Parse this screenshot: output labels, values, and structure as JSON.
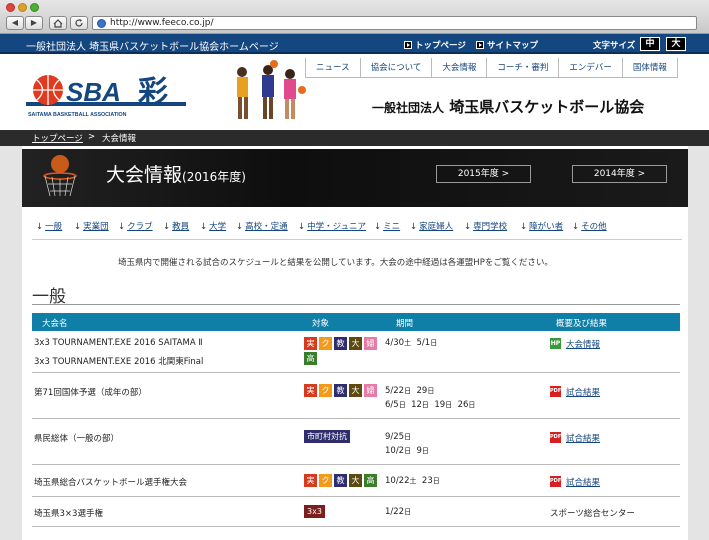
{
  "browser": {
    "back": "◀",
    "forward": "▶",
    "url": "http://www.feeco.co.jp/"
  },
  "site": {
    "topbar_title": "一般社団法人 埼玉県バスケットボール協会ホームページ",
    "topnav": [
      "トップページ",
      "サイトマップ"
    ],
    "font_size_label": "文字サイズ",
    "font_size_options": [
      "中",
      "大"
    ],
    "menu": [
      "ニュース",
      "協会について",
      "大会情報",
      "コーチ・審判",
      "エンデバー",
      "国体情報"
    ],
    "logo_text": "SBA",
    "logo_kanji": "彩",
    "logo_sub": "SAITAMA BASKETBALL ASSOCIATION",
    "org_prefix": "一般社団法人",
    "org_name": "埼玉県バスケットボール協会"
  },
  "breadcrumb": {
    "home": "トップページ",
    "sep": ">",
    "current": "大会情報"
  },
  "banner": {
    "title": "大会情報",
    "year": "(2016年度)",
    "buttons": [
      "2015年度 >",
      "2014年度 >"
    ]
  },
  "categories": [
    "一般",
    "実業団",
    "クラブ",
    "教員",
    "大学",
    "高校・定通",
    "中学・ジュニア",
    "ミニ",
    "家庭婦人",
    "専門学校",
    "障がい者",
    "その他"
  ],
  "intro": "埼玉県内で開催される試合のスケジュールと結果を公開しています。大会の途中経過は各運盟HPをご覧ください。",
  "section": "一般",
  "table": {
    "headers": [
      "大会名",
      "対象",
      "期間",
      "概要及び結果"
    ],
    "rows": [
      {
        "name1": "3x3 TOURNAMENT.EXE 2016 SAITAMA Ⅱ",
        "name2": "3x3 TOURNAMENT.EXE 2016 北関東Final",
        "tags": [
          "実",
          "ク",
          "教",
          "大",
          "婦",
          "高"
        ],
        "period1": "4/30",
        "period1_dow": "土",
        "period1b": "5/1",
        "period1b_dow": "日",
        "result_icon": "HP",
        "result": "大会情報"
      },
      {
        "name1": "第71回国体予選（成年の部）",
        "tags": [
          "実",
          "ク",
          "教",
          "大",
          "婦"
        ],
        "period1": "5/22",
        "period1_dow": "日",
        "period1b": "29",
        "period1b_dow": "日",
        "period2": "6/5",
        "period2_dow": "日",
        "period2b": "12",
        "period2b_dow": "日",
        "period2c": "19",
        "period2c_dow": "日",
        "period2d": "26",
        "period2d_dow": "日",
        "result_icon": "PDF",
        "result": "試合結果"
      },
      {
        "name1": "県民総体（一般の部）",
        "tag_wide": "市町村対抗",
        "period1": "9/25",
        "period1_dow": "日",
        "period2": "10/2",
        "period2_dow": "日",
        "period2b": "9",
        "period2b_dow": "日",
        "result_icon": "PDF",
        "result": "試合結果"
      },
      {
        "name1": "埼玉県総合バスケットボール選手権大会",
        "tags": [
          "実",
          "ク",
          "教",
          "大",
          "高"
        ],
        "period1": "10/22",
        "period1_dow": "土",
        "period1b": "23",
        "period1b_dow": "日",
        "result_icon": "PDF",
        "result": "試合結果"
      },
      {
        "name1": "埼玉県3×3選手権",
        "tag_wide": "3x3",
        "period1": "1/22",
        "period1_dow": "日",
        "result_text": "スポーツ総合センター"
      }
    ]
  },
  "colors": {
    "topbar": "#14467f",
    "table_header": "#0f7fa8",
    "tag_red": "#d63a1f",
    "tag_orange": "#f19a1b",
    "tag_navy": "#2e2e6e",
    "tag_olive": "#5c4a10",
    "tag_pink": "#e87aa8",
    "tag_green": "#3a7d2a"
  }
}
